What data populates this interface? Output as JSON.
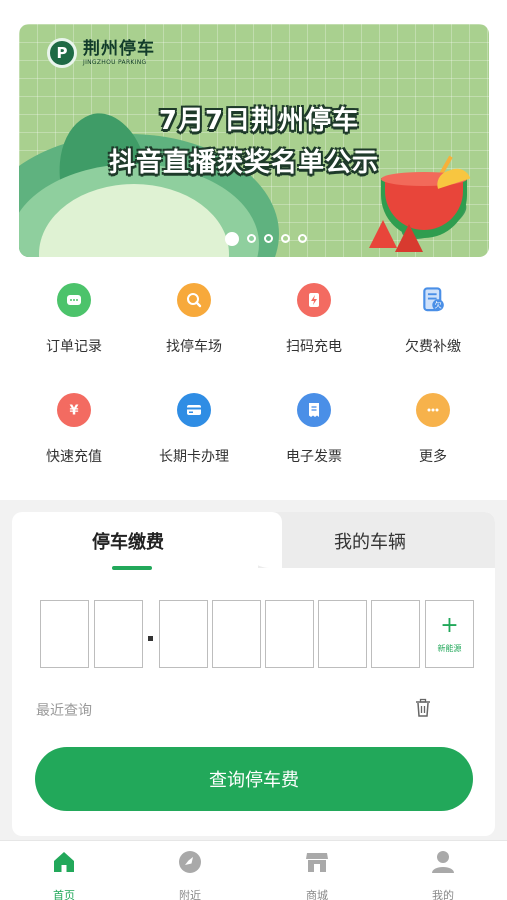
{
  "banner": {
    "logo_title": "荆州停车",
    "logo_sub": "JINGZHOU PARKING",
    "headline_1": "7月7日荆州停车",
    "headline_2": "抖音直播获奖名单公示",
    "slides": 5,
    "active_slide": 1
  },
  "services": [
    {
      "label": "订单记录",
      "icon": "order-list-icon",
      "color": "#4cc36b"
    },
    {
      "label": "找停车场",
      "icon": "search-parking-icon",
      "color": "#f7a93b"
    },
    {
      "label": "扫码充电",
      "icon": "charge-icon",
      "color": "#f36b61"
    },
    {
      "label": "欠费补缴",
      "icon": "arrears-icon",
      "color": "#4a8fe7"
    },
    {
      "label": "快速充值",
      "icon": "recharge-icon",
      "color": "#f36b61"
    },
    {
      "label": "长期卡办理",
      "icon": "card-icon",
      "color": "#2f8de4"
    },
    {
      "label": "电子发票",
      "icon": "invoice-icon",
      "color": "#4a8fe7"
    },
    {
      "label": "更多",
      "icon": "more-icon",
      "color": "#f7b24b"
    }
  ],
  "tabs": {
    "active": "停车缴费",
    "inactive": "我的车辆"
  },
  "plate": {
    "new_energy_label": "新能源",
    "new_energy_plus": "+"
  },
  "recent": {
    "label": "最近查询"
  },
  "query_button": "查询停车费",
  "nav": [
    {
      "label": "首页",
      "icon": "home-icon",
      "active": true
    },
    {
      "label": "附近",
      "icon": "compass-icon",
      "active": false
    },
    {
      "label": "商城",
      "icon": "shop-icon",
      "active": false
    },
    {
      "label": "我的",
      "icon": "profile-icon",
      "active": false
    }
  ],
  "colors": {
    "accent": "#22a85a",
    "background_gray": "#f2f2f2"
  }
}
